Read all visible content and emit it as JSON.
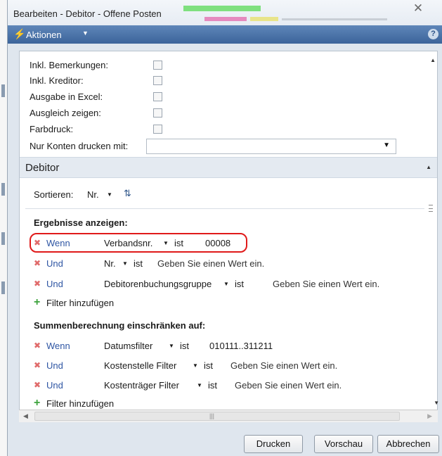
{
  "window": {
    "title": "Bearbeiten - Debitor - Offene Posten",
    "close_glyph": "✕"
  },
  "actions": {
    "label": "Aktionen",
    "help_glyph": "?"
  },
  "options": [
    {
      "label": "Inkl. Bemerkungen:",
      "checked": false
    },
    {
      "label": "Inkl. Kreditor:",
      "checked": false
    },
    {
      "label": "Ausgabe in Excel:",
      "checked": false
    },
    {
      "label": "Ausgleich zeigen:",
      "checked": false
    },
    {
      "label": "Farbdruck:",
      "checked": false
    }
  ],
  "account_filter": {
    "label": "Nur Konten drucken mit:",
    "value": ""
  },
  "section": {
    "title": "Debitor",
    "sort_label": "Sortieren:",
    "sort_value": "Nr."
  },
  "results": {
    "title": "Ergebnisse anzeigen:",
    "rows": [
      {
        "conj": "Wenn",
        "field": "Verbandsnr.",
        "op": "ist",
        "value": "00008"
      },
      {
        "conj": "Und",
        "field": "Nr.",
        "op": "ist",
        "value": "Geben Sie einen Wert ein."
      },
      {
        "conj": "Und",
        "field": "Debitorenbuchungsgruppe",
        "op": "ist",
        "value": "Geben Sie einen Wert ein."
      }
    ],
    "add_filter": "Filter hinzufügen"
  },
  "totals": {
    "title": "Summenberechnung einschränken auf:",
    "rows": [
      {
        "conj": "Wenn",
        "field": "Datumsfilter",
        "op": "ist",
        "value": "010111..311211"
      },
      {
        "conj": "Und",
        "field": "Kostenstelle Filter",
        "op": "ist",
        "value": "Geben Sie einen Wert ein."
      },
      {
        "conj": "Und",
        "field": "Kostenträger Filter",
        "op": "ist",
        "value": "Geben Sie einen Wert ein."
      }
    ],
    "add_filter": "Filter hinzufügen"
  },
  "buttons": {
    "print": "Drucken",
    "preview": "Vorschau",
    "cancel": "Abbrechen"
  },
  "colors": {
    "action_bar": "#4a73a8",
    "highlight": "#e01a1a",
    "link": "#2e55a3",
    "remove": "#e06b6b",
    "add": "#3da33d"
  }
}
